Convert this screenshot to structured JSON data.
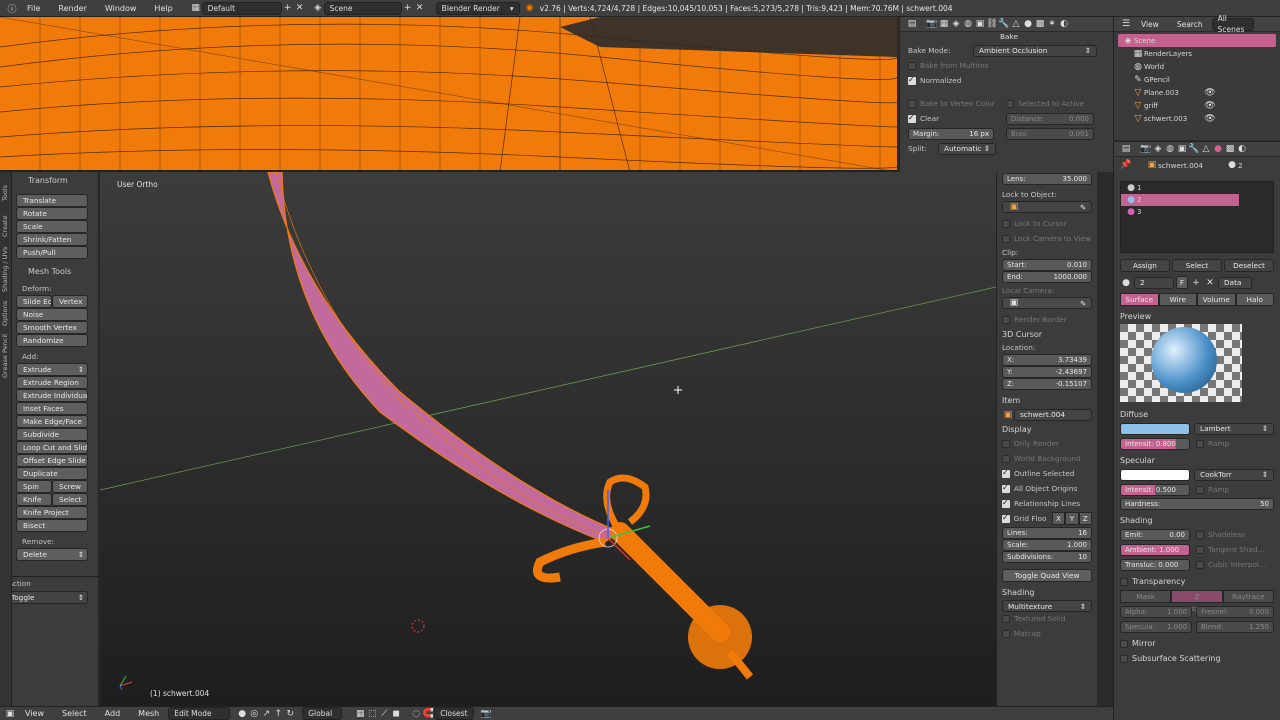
{
  "topbar": {
    "menus": [
      "File",
      "Render",
      "Window",
      "Help"
    ],
    "screen_layout": "Default",
    "scene": "Scene",
    "engine": "Blender Render",
    "stats": "v2.76 | Verts:4,724/4,728 | Edges:10,045/10,053 | Faces:5,273/5,278 | Tris:9,423 | Mem:70.76M | schwert.004"
  },
  "toolshelf": {
    "tabs": [
      "Tools",
      "Create",
      "Shading / UVs",
      "Options",
      "Grease Pencil"
    ],
    "transform_header": "Transform",
    "transform": [
      "Translate",
      "Rotate",
      "Scale",
      "Shrink/Fatten",
      "Push/Pull"
    ],
    "mesh_tools_header": "Mesh Tools",
    "deform_label": "Deform:",
    "slide_edge": "Slide Ed",
    "vertex": "Vertex",
    "deform": [
      "Noise",
      "Smooth Vertex",
      "Randomize"
    ],
    "add_label": "Add:",
    "extrude": "Extrude",
    "add": [
      "Extrude Region",
      "Extrude Individual",
      "Inset Faces",
      "Make Edge/Face",
      "Subdivide",
      "Loop Cut and Slide",
      "Offset Edge Slide",
      "Duplicate"
    ],
    "spin": "Spin",
    "screw": "Screw",
    "knife": "Knife",
    "select": "Select",
    "add2": [
      "Knife Project",
      "Bisect"
    ],
    "remove_label": "Remove:",
    "delete": "Delete",
    "action_header": "Action",
    "toggle": "Toggle"
  },
  "viewport": {
    "view_name": "User Ortho",
    "object_label": "(1) schwert.004"
  },
  "bake": {
    "header": "Bake",
    "bake_mode_label": "Bake Mode:",
    "bake_mode": "Ambient Occlusion",
    "bake_from_multires": "Bake from Multires",
    "normalized": "Normalized",
    "bake_to_vertex_color": "Bake to Vertex Color",
    "selected_to_active": "Selected to Active",
    "clear": "Clear",
    "distance_label": "Distance:",
    "distance": "0.000",
    "margin_label": "Margin:",
    "margin": "16 px",
    "bias_label": "Bias:",
    "bias": "0.001",
    "split_label": "Split:",
    "split": "Automatic"
  },
  "npanel": {
    "lens": "Lens:",
    "lens_val": "35.000",
    "lock_to_object": "Lock to Object:",
    "lock_to_cursor": "Lock to Cursor",
    "lock_camera_to_view": "Lock Camera to View",
    "clip": "Clip:",
    "start_label": "Start:",
    "start": "0.010",
    "end_label": "End:",
    "end": "1000.000",
    "local_camera": "Local Camera:",
    "render_border": "Render Border",
    "cursor_header": "3D Cursor",
    "location": "Location:",
    "x_label": "X:",
    "x": "3.73439",
    "y_label": "Y:",
    "y": "-2.43697",
    "z_label": "Z:",
    "z": "-0.15107",
    "item_header": "Item",
    "item_name": "schwert.004",
    "display_header": "Display",
    "only_render": "Only Render",
    "world_background": "World Background",
    "outline_selected": "Outline Selected",
    "all_object_origins": "All Object Origins",
    "relationship_lines": "Relationship Lines",
    "grid_floor": "Grid Floo",
    "grid_x": "X",
    "grid_y": "Y",
    "grid_z": "Z",
    "lines_label": "Lines:",
    "lines": "16",
    "scale_label": "Scale:",
    "scale": "1.000",
    "subdiv_label": "Subdivisions:",
    "subdiv": "10",
    "toggle_quad": "Toggle Quad View",
    "shading_header": "Shading",
    "shading_mode": "Multitexture",
    "textured_solid": "Textured Solid",
    "matcap": "Matcap"
  },
  "outliner": {
    "view": "View",
    "search": "Search",
    "all_scenes": "All Scenes",
    "items": [
      "Scene",
      "RenderLayers",
      "World",
      "GPencil",
      "Plane.003",
      "griff",
      "schwert.003"
    ]
  },
  "props": {
    "object_name": "schwert.004",
    "count": "2",
    "slots": [
      "1",
      "2",
      "3"
    ],
    "assign": "Assign",
    "select": "Select",
    "deselect": "Deselect",
    "material_num": "2",
    "material_f": "F",
    "data": "Data",
    "tabs": [
      "Surface",
      "Wire",
      "Volume",
      "Halo"
    ],
    "preview": "Preview",
    "diffuse": "Diffuse",
    "lambert": "Lambert",
    "diffuse_intensity": "Intensit: 0.800",
    "ramp": "Ramp",
    "specular": "Specular",
    "cooktorr": "CookTorr",
    "spec_intensity": "Intensit: 0.500",
    "hardness_label": "Hardness:",
    "hardness": "50",
    "shading": "Shading",
    "emit": "Emit:",
    "emit_val": "0.00",
    "shadeless": "Shadeless",
    "ambient": "Ambient: 1.000",
    "tangent_shading": "Tangent Shad...",
    "translucency": "Transluc: 0.000",
    "cubic_interp": "Cubic Interpol...",
    "transparency": "Transparency",
    "mask": "Mask",
    "z_transparency": "Z Transpare...",
    "raytrace": "Raytrace",
    "alpha": "Alpha:",
    "alpha_val": "1.000",
    "fresnel": "Fresnel:",
    "fresnel_val": "0.000",
    "specular_val_label": "Specula:",
    "specular_val": "1.000",
    "blend": "Blend:",
    "blend_val": "1.250",
    "mirror": "Mirror",
    "sss": "Subsurface Scattering"
  },
  "bottombar": {
    "view": "View",
    "select": "Select",
    "add": "Add",
    "mesh": "Mesh",
    "mode": "Edit Mode",
    "orientation": "Global",
    "snap": "Closest"
  },
  "colors": {
    "accent_orange": "#f07b0a",
    "selection_pink": "#c4628f",
    "diffuse_color": "#8ec0ea"
  }
}
